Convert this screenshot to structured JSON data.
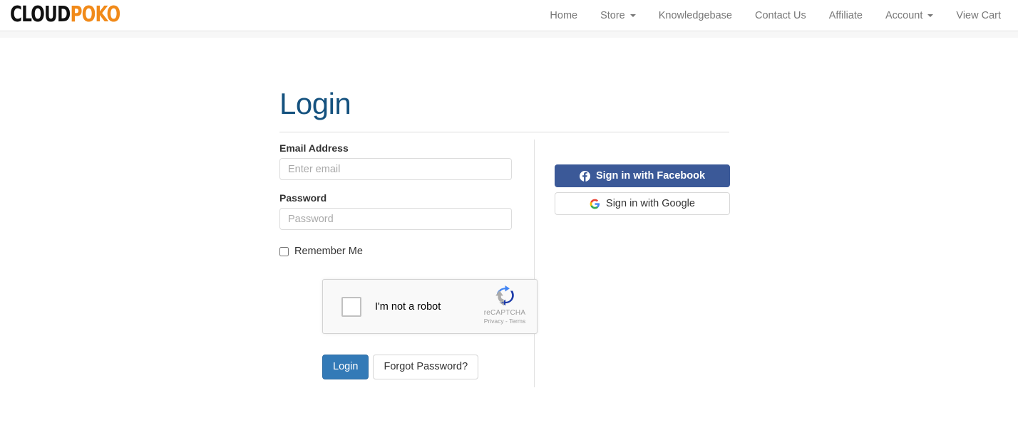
{
  "brand": {
    "part1": "CLOUD",
    "part2": "POKO",
    "color1": "#111111",
    "color2": "#f18a19"
  },
  "nav": {
    "items": [
      {
        "label": "Home",
        "has_caret": false
      },
      {
        "label": "Store",
        "has_caret": true
      },
      {
        "label": "Knowledgebase",
        "has_caret": false
      },
      {
        "label": "Contact Us",
        "has_caret": false
      },
      {
        "label": "Affiliate",
        "has_caret": false
      },
      {
        "label": "Account",
        "has_caret": true
      },
      {
        "label": "View Cart",
        "has_caret": false
      }
    ]
  },
  "main": {
    "title": "Login",
    "title_color": "#15527f",
    "form": {
      "email": {
        "label": "Email Address",
        "placeholder": "Enter email",
        "value": ""
      },
      "password": {
        "label": "Password",
        "placeholder": "Password",
        "value": ""
      },
      "remember": {
        "label": "Remember Me",
        "checked": false
      }
    },
    "recaptcha": {
      "checkbox_label": "I'm not a robot",
      "brand_name": "reCAPTCHA",
      "privacy_label": "Privacy",
      "separator": "-",
      "terms_label": "Terms",
      "checked": false
    },
    "buttons": {
      "login": "Login",
      "forgot": "Forgot Password?",
      "login_color": "#337ab7"
    },
    "social": {
      "facebook": {
        "label": "Sign in with Facebook",
        "color": "#3b5998"
      },
      "google": {
        "label": "Sign in with Google"
      }
    }
  }
}
